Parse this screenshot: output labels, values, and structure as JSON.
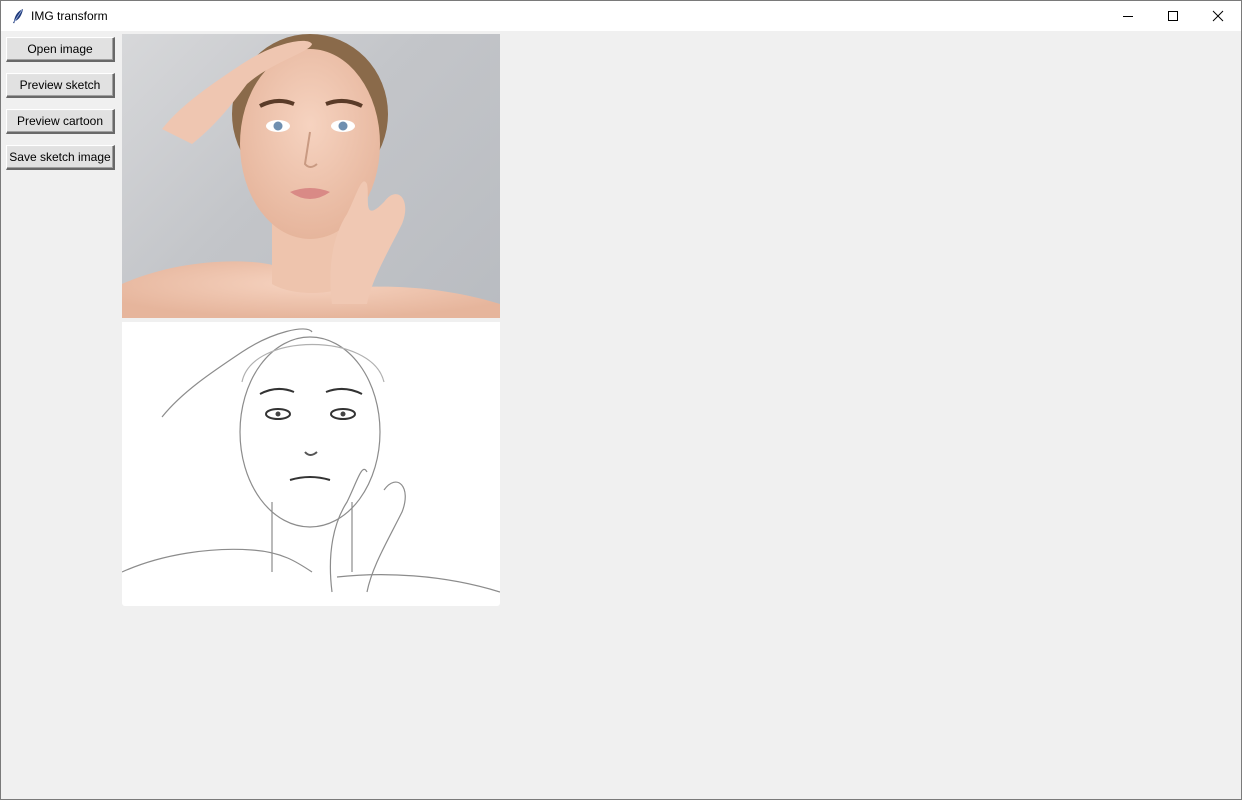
{
  "window": {
    "title": "IMG transform",
    "app_icon": "feather-icon",
    "controls": [
      "minimize-icon",
      "maximize-icon",
      "close-icon"
    ]
  },
  "toolbar": {
    "open_label": "Open image",
    "preview_sketch_label": "Preview sketch",
    "preview_cartoon_label": "Preview cartoon",
    "save_sketch_label": "Save sketch image"
  },
  "panels": {
    "original": "original-photo",
    "sketch": "sketch-preview"
  },
  "colors": {
    "background": "#f0f0f0",
    "titlebar": "#ffffff",
    "button_face": "#e1e1e1"
  }
}
